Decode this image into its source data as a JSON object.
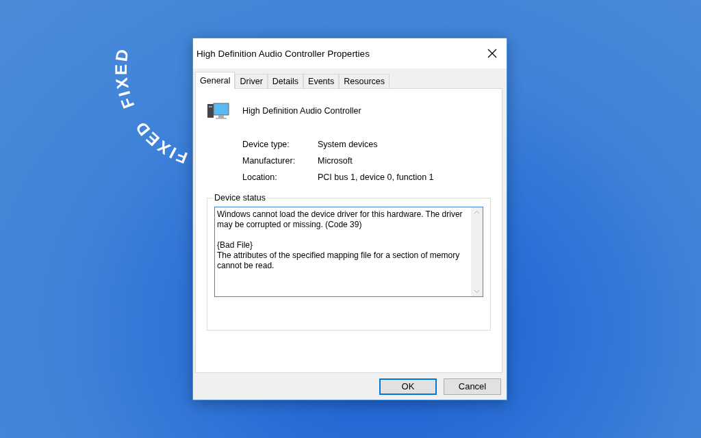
{
  "background": {
    "ring_words": [
      "FIXED",
      "FIXED"
    ]
  },
  "window": {
    "title": "High Definition Audio Controller Properties"
  },
  "tabs": [
    {
      "label": "General",
      "selected": true
    },
    {
      "label": "Driver",
      "selected": false
    },
    {
      "label": "Details",
      "selected": false
    },
    {
      "label": "Events",
      "selected": false
    },
    {
      "label": "Resources",
      "selected": false
    }
  ],
  "device": {
    "name": "High Definition Audio Controller"
  },
  "properties": [
    {
      "label": "Device type:",
      "value": "System devices"
    },
    {
      "label": "Manufacturer:",
      "value": "Microsoft"
    },
    {
      "label": "Location:",
      "value": "PCI bus 1, device 0, function 1"
    }
  ],
  "device_status": {
    "title": "Device status",
    "paragraphs": [
      "Windows cannot load the device driver for this hardware. The driver may be corrupted or missing. (Code 39)",
      "{Bad File}\nThe attributes of the specified mapping file for a section of memory cannot be read."
    ]
  },
  "buttons": [
    {
      "label": "OK",
      "selected": true
    },
    {
      "label": "Cancel",
      "selected": false
    }
  ]
}
